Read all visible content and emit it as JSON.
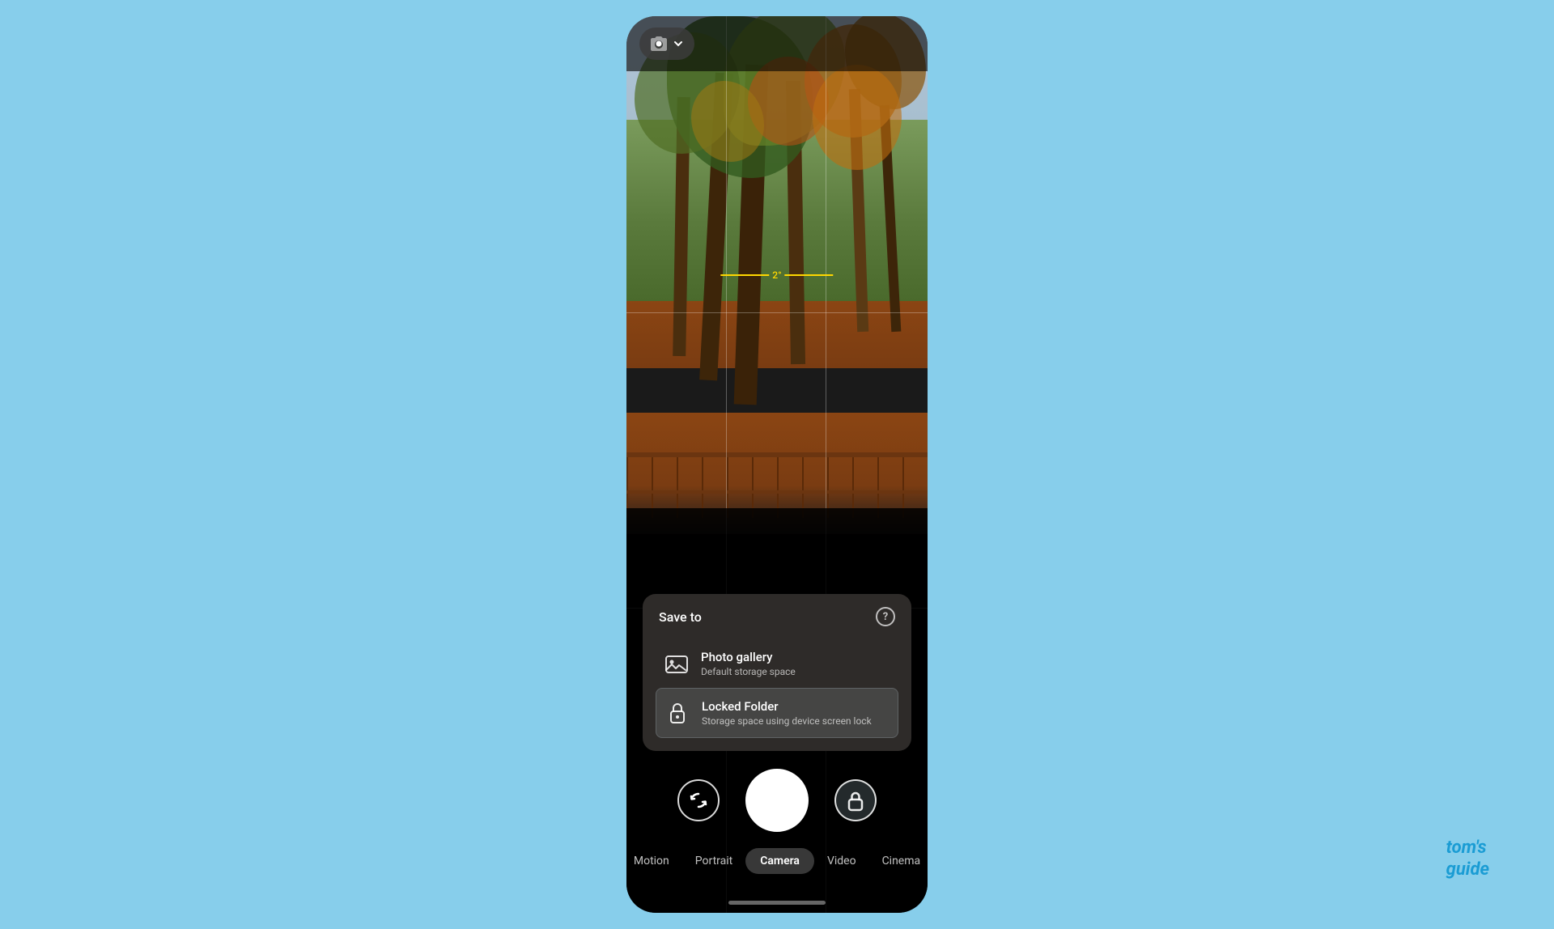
{
  "phone": {
    "topBar": {
      "cameraModeLabel": "📷",
      "chevron": "▾"
    },
    "viewfinder": {
      "levelDegree": "2°"
    },
    "saveToPanel": {
      "title": "Save to",
      "helpIcon": "?",
      "options": [
        {
          "id": "photo-gallery",
          "name": "Photo gallery",
          "description": "Default storage space",
          "icon": "gallery"
        },
        {
          "id": "locked-folder",
          "name": "Locked Folder",
          "description": "Storage space using device screen lock",
          "icon": "lock"
        }
      ]
    },
    "bottomControls": {
      "flipLabel": "↺",
      "lockedLabel": "🔒"
    },
    "modeTabs": [
      {
        "id": "motion",
        "label": "Motion",
        "active": false
      },
      {
        "id": "portrait",
        "label": "Portrait",
        "active": false
      },
      {
        "id": "camera",
        "label": "Camera",
        "active": true
      },
      {
        "id": "video",
        "label": "Video",
        "active": false
      },
      {
        "id": "cinema",
        "label": "Cinema",
        "active": false
      }
    ]
  },
  "watermark": {
    "line1": "tom's",
    "line2": "guide"
  }
}
